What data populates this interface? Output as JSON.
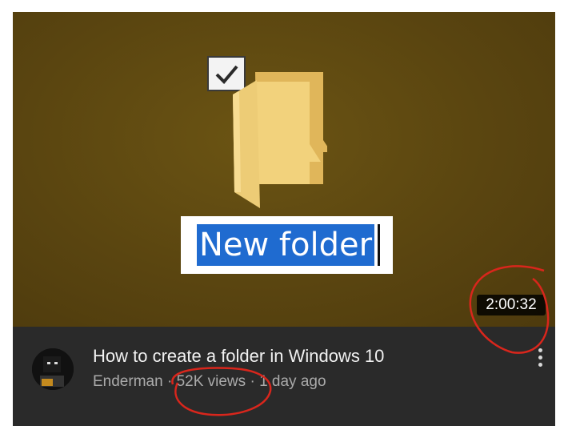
{
  "video": {
    "thumbnail": {
      "rename_text": "New folder",
      "duration": "2:00:32"
    },
    "title": "How to create a folder in Windows 10",
    "channel": "Enderman",
    "separator": "·",
    "views": "52K views",
    "age": "1 day ago"
  },
  "icons": {
    "checkbox": "checkbox-checked-icon",
    "folder": "folder-icon",
    "avatar": "channel-avatar",
    "menu": "more-vertical-icon"
  },
  "colors": {
    "thumbnail_bg": "#5a4510",
    "selection": "#1f6bd0",
    "annotation": "#d9261c",
    "card_bg": "#2a2a2a"
  }
}
